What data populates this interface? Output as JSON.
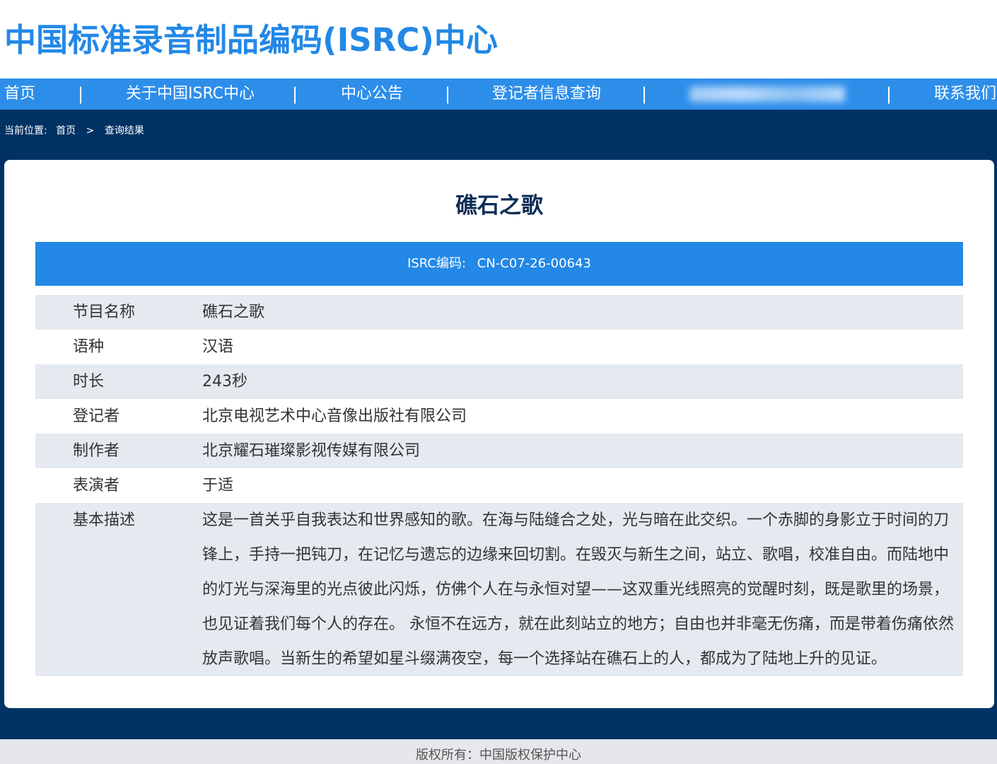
{
  "header": {
    "site_title": "中国标准录音制品编码(ISRC)中心"
  },
  "nav": {
    "items": [
      {
        "label": "首页"
      },
      {
        "label": "关于中国ISRC中心"
      },
      {
        "label": "中心公告"
      },
      {
        "label": "登记者信息查询"
      },
      {
        "label": ""
      },
      {
        "label": "联系我们"
      }
    ],
    "separator": "|"
  },
  "breadcrumb": {
    "prefix": "当前位置:",
    "home": "首页",
    "separator": ">",
    "current": "查询结果"
  },
  "record": {
    "title": "礁石之歌",
    "isrc_label": "ISRC编码:",
    "isrc_code": "CN-C07-26-00643",
    "fields": [
      {
        "label": "节目名称",
        "value": "礁石之歌"
      },
      {
        "label": "语种",
        "value": "汉语"
      },
      {
        "label": "时长",
        "value": "243秒"
      },
      {
        "label": "登记者",
        "value": "北京电视艺术中心音像出版社有限公司"
      },
      {
        "label": "制作者",
        "value": "北京耀石璀璨影视传媒有限公司"
      },
      {
        "label": "表演者",
        "value": "于适"
      },
      {
        "label": "基本描述",
        "value": "这是一首关乎自我表达和世界感知的歌。在海与陆缝合之处，光与暗在此交织。一个赤脚的身影立于时间的刀锋上，手持一把钝刀，在记忆与遗忘的边缘来回切割。在毁灭与新生之间，站立、歌唱，校准自由。而陆地中的灯光与深海里的光点彼此闪烁，仿佛个人在与永恒对望——这双重光线照亮的觉醒时刻，既是歌里的场景，也见证着我们每个人的存在。 永恒不在远方，就在此刻站立的地方；自由也并非毫无伤痛，而是带着伤痛依然放声歌唱。当新生的希望如星斗缀满夜空，每一个选择站在礁石上的人，都成为了陆地上升的见证。"
      }
    ]
  },
  "footer": {
    "copyright": "版权所有：中国版权保护中心"
  },
  "colors": {
    "brand_blue": "#2388e6",
    "nav_blue": "#2d8eea",
    "dark_navy": "#003264",
    "row_stripe": "#e5eaf0"
  }
}
